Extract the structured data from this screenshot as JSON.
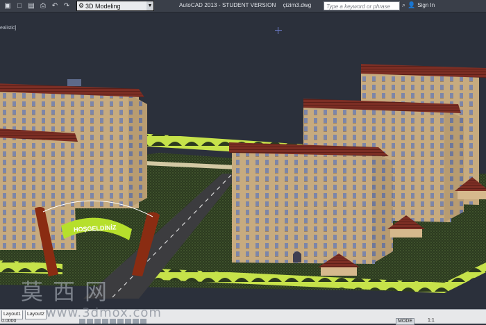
{
  "app": {
    "title": "AutoCAD 2013 - STUDENT VERSION",
    "filename": "çizim3.dwg"
  },
  "toolbar": {
    "workspace": "3D Modeling",
    "search_placeholder": "Type a keyword or phrase",
    "signin_label": "Sign In",
    "quick_access_icons": [
      "new-file-icon",
      "open-icon",
      "save-icon",
      "print-icon",
      "undo-icon",
      "redo-icon"
    ]
  },
  "viewport": {
    "style_label": "ealistic]",
    "gate_sign": "HOŞGELDİNİZ",
    "background_color": "#2b303b"
  },
  "status": {
    "tab1": "Layout1",
    "tab2": "Layout2",
    "coords": "0.0000",
    "mode": "MODE",
    "scale": "1:1"
  },
  "watermark": {
    "chars": "莫西网",
    "url": "www.3dmox.com"
  }
}
